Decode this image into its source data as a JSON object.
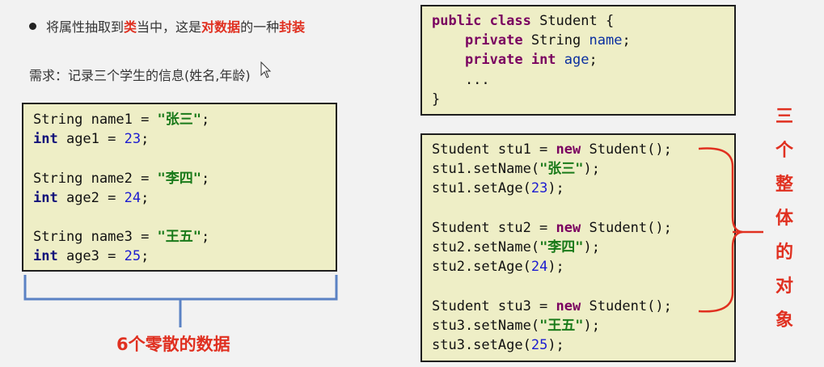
{
  "intro": {
    "prefix": "将属性抽取到",
    "hl1": "类",
    "mid1": "当中，这是",
    "hl2": "对数据",
    "mid2": "的一种",
    "hl3": "封装"
  },
  "requirement": "需求：记录三个学生的信息(姓名,年龄)",
  "left_code": {
    "line1_type": "String",
    "line1_var": " name1 = ",
    "line1_str": "\"张三\"",
    "line1_end": ";",
    "line2_type": "int",
    "line2_var": " age1 = ",
    "line2_num": "23",
    "line2_end": ";",
    "line3_type": "String",
    "line3_var": " name2 = ",
    "line3_str": "\"李四\"",
    "line3_end": ";",
    "line4_type": "int",
    "line4_var": " age2 = ",
    "line4_num": "24",
    "line4_end": ";",
    "line5_type": "String",
    "line5_var": " name3 = ",
    "line5_str": "\"王五\"",
    "line5_end": ";",
    "line6_type": "int",
    "line6_var": " age3 = ",
    "line6_num": "25",
    "line6_end": ";"
  },
  "class_code": {
    "kw_public": "public",
    "kw_class": " class",
    "class_name": " Student {",
    "kw_private1": "    private",
    "field1_type": " String ",
    "field1_name": "name",
    "field1_end": ";",
    "kw_private2": "    private",
    "field2_type": " int",
    "field2_sp": " ",
    "field2_name": "age",
    "field2_end": ";",
    "ellipsis": "    ...",
    "close": "}"
  },
  "object_code": {
    "o1_decl": "Student stu1 = ",
    "o1_new": "new",
    "o1_ctor": " Student();",
    "o1_set_name": "stu1.setName(",
    "o1_name": "\"张三\"",
    "o1_set_name_end": ");",
    "o1_set_age": "stu1.setAge(",
    "o1_age": "23",
    "o1_set_age_end": ");",
    "o2_decl": "Student stu2 = ",
    "o2_new": "new",
    "o2_ctor": " Student();",
    "o2_set_name": "stu2.setName(",
    "o2_name": "\"李四\"",
    "o2_set_name_end": ");",
    "o2_set_age": "stu2.setAge(",
    "o2_age": "24",
    "o2_set_age_end": ");",
    "o3_decl": "Student stu3 = ",
    "o3_new": "new",
    "o3_ctor": " Student();",
    "o3_set_name": "stu3.setName(",
    "o3_name": "\"王五\"",
    "o3_set_name_end": ");",
    "o3_set_age": "stu3.setAge(",
    "o3_age": "25",
    "o3_set_age_end": ");"
  },
  "caption_bottom": "6个零散的数据",
  "caption_right": [
    "三",
    "个",
    "整",
    "体",
    "的",
    "对",
    "象"
  ],
  "colors": {
    "accent": "#e03020",
    "bracket_blue": "#5b82c4",
    "code_bg": "#eeeec6"
  },
  "icons": {
    "cursor": "mouse-pointer-icon"
  }
}
